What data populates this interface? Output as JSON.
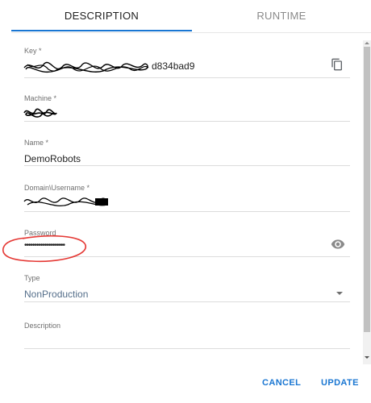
{
  "tabs": [
    {
      "label": "DESCRIPTION",
      "active": true
    },
    {
      "label": "RUNTIME",
      "active": false
    }
  ],
  "fields": {
    "key": {
      "label": "Key *",
      "value_visible": "d834bad9",
      "icon": "copy-icon"
    },
    "machine": {
      "label": "Machine *"
    },
    "name": {
      "label": "Name *",
      "value": "DemoRobots"
    },
    "domain_username": {
      "label": "Domain\\Username *"
    },
    "password": {
      "label": "Password",
      "value": "••••••••••••••••••••",
      "icon": "eye-icon"
    },
    "type": {
      "label": "Type",
      "value": "NonProduction",
      "icon": "dropdown-arrow-icon"
    },
    "description": {
      "label": "Description",
      "value": ""
    }
  },
  "footer": {
    "cancel_label": "CANCEL",
    "update_label": "UPDATE"
  },
  "colors": {
    "accent": "#1976d2",
    "annotation_circle": "#e53935",
    "type_value": "#546e8a"
  }
}
